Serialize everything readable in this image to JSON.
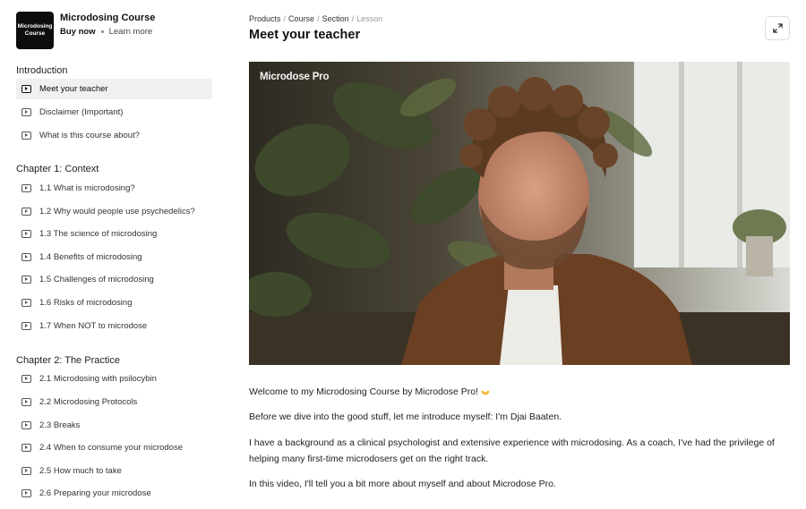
{
  "product": {
    "logo_text_line1": "Microdosing",
    "logo_text_line2": "Course",
    "title": "Microdosing Course",
    "buy_now": "Buy now",
    "learn_more": "Learn more"
  },
  "sidebar": {
    "sections": [
      {
        "title": "Introduction",
        "lessons": [
          "Meet your teacher",
          "Disclaimer (Important)",
          "What is this course about?"
        ]
      },
      {
        "title": "Chapter 1: Context",
        "lessons": [
          "1.1 What is microdosing?",
          "1.2 Why would people use psychedelics?",
          "1.3 The science of microdosing",
          "1.4 Benefits of microdosing",
          "1.5 Challenges of microdosing",
          "1.6 Risks of microdosing",
          "1.7 When NOT to microdose"
        ]
      },
      {
        "title": "Chapter 2: The Practice",
        "lessons": [
          "2.1 Microdosing with psilocybin",
          "2.2 Microdosing Protocols",
          "2.3 Breaks",
          "2.4 When to consume your microdose",
          "2.5 How much to take",
          "2.6 Preparing your microdose"
        ]
      }
    ],
    "active_lesson": "Meet your teacher"
  },
  "breadcrumb": [
    "Products",
    "Course",
    "Section",
    "Lesson"
  ],
  "page_title": "Meet your teacher",
  "video": {
    "watermark": "Microdose Pro"
  },
  "content": {
    "p1": "Welcome to my Microdosing Course by Microdose Pro!",
    "p2": "Before we dive into the good stuff, let me introduce myself: I'm Djai Baaten.",
    "p3": "I have a background as a clinical psychologist and extensive experience with microdosing. As a coach, I've had the privilege of helping many first-time microdosers get on the right track.",
    "p4": "In this video, I'll tell you a bit more about myself and about Microdose Pro."
  },
  "icons": {
    "lesson": "play-video-icon",
    "expand": "expand-icon",
    "emoji": "raised-hands-emoji"
  },
  "colors": {
    "active_lesson_bg": "#f0f0f2",
    "logo_bg": "#0d0d0d"
  }
}
